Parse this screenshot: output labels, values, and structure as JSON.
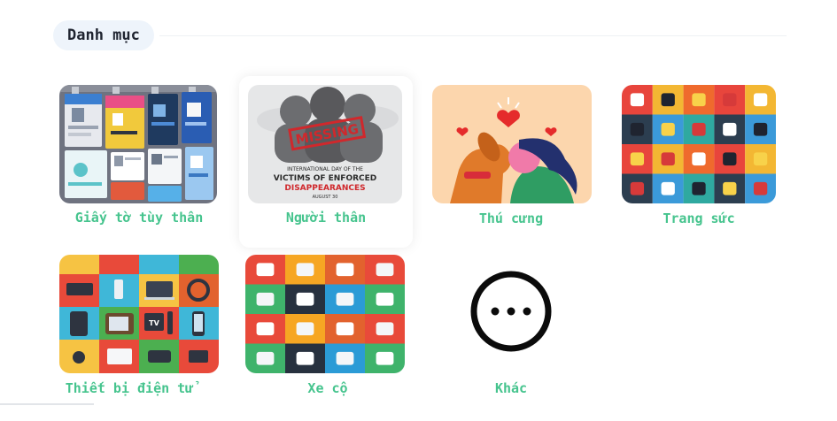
{
  "section": {
    "title": "Danh mục"
  },
  "categories": [
    {
      "id": "id",
      "label": "Giấy tờ tùy thân",
      "icon": "id-cards-image"
    },
    {
      "id": "missing",
      "label": "Người thân",
      "icon": "missing-person-poster-image",
      "poster": {
        "stamp": "MISSING",
        "line1": "INTERNATIONAL DAY OF THE",
        "line2": "VICTIMS OF ENFORCED",
        "line3": "DISAPPEARANCES",
        "line4": "AUGUST 30"
      }
    },
    {
      "id": "pets",
      "label": "Thú cưng",
      "icon": "pet-love-image"
    },
    {
      "id": "jewelry",
      "label": "Trang sức",
      "icon": "fashion-accessories-image"
    },
    {
      "id": "electronics",
      "label": "Thiết bị điện tử",
      "icon": "electronics-grid-image",
      "tv_text": "TV"
    },
    {
      "id": "vehicles",
      "label": "Xe cộ",
      "icon": "vehicles-grid-image"
    },
    {
      "id": "other",
      "label": "Khác",
      "icon": "more-dots-icon"
    }
  ],
  "colors": {
    "accent_label": "#46c48e",
    "title_pill_bg": "#eef4fb",
    "title_text": "#1f2430"
  }
}
